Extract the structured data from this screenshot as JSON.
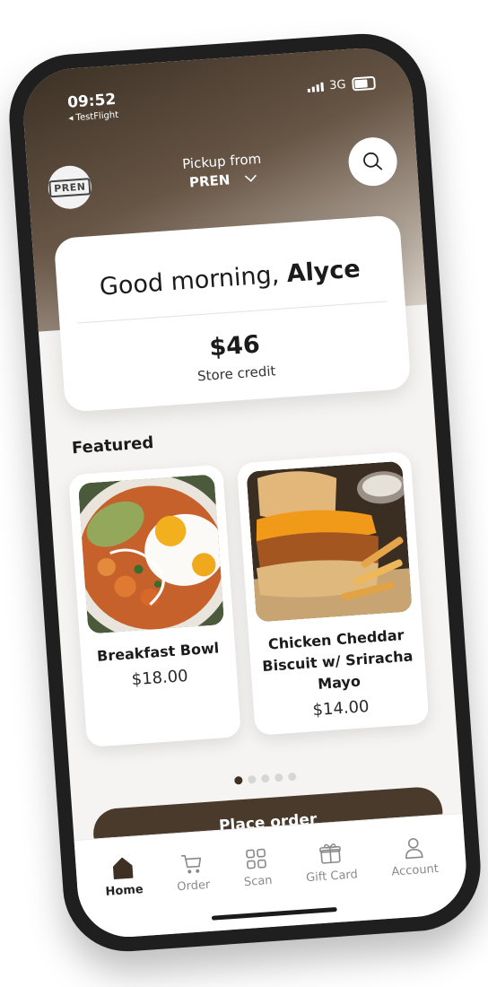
{
  "status": {
    "time": "09:52",
    "back_app": "◂ TestFlight",
    "network": "3G"
  },
  "header": {
    "logo_text": "PREN",
    "pickup_label": "Pickup from",
    "pickup_store": "PREN"
  },
  "greeting": {
    "prefix": "Good morning,",
    "name": "Alyce"
  },
  "credit": {
    "amount": "$46",
    "label": "Store credit"
  },
  "featured": {
    "title": "Featured",
    "items": [
      {
        "name": "Breakfast Bowl",
        "price": "$18.00",
        "icon": "breakfast-bowl-photo"
      },
      {
        "name": "Chicken Cheddar Biscuit w/ Sriracha Mayo",
        "price": "$14.00",
        "icon": "chicken-biscuit-photo"
      }
    ],
    "page_count": 5,
    "active_page": 1
  },
  "cta": {
    "label": "Place order"
  },
  "tabs": [
    {
      "label": "Home",
      "icon": "home-icon",
      "active": true
    },
    {
      "label": "Order",
      "icon": "cart-icon",
      "active": false
    },
    {
      "label": "Scan",
      "icon": "qr-scan-icon",
      "active": false
    },
    {
      "label": "Gift Card",
      "icon": "gift-card-icon",
      "active": false
    },
    {
      "label": "Account",
      "icon": "account-icon",
      "active": false
    }
  ],
  "colors": {
    "brand": "#4a3a2c",
    "header_dark": "#3c3125",
    "active_tab": "#222222",
    "inactive_tab": "#8a8a8a"
  }
}
